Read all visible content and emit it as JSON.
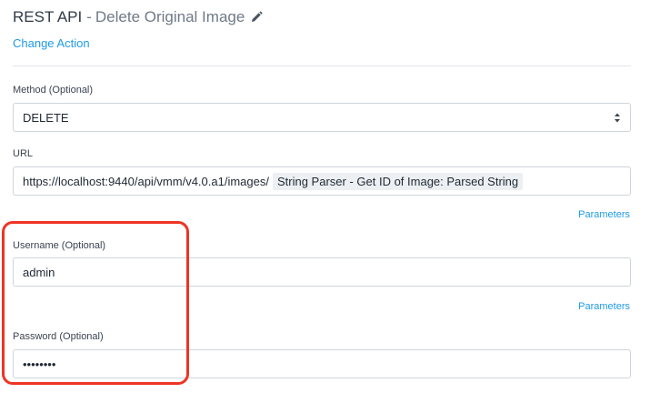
{
  "header": {
    "title": "REST API",
    "separator": "-",
    "subtitle": "Delete Original Image",
    "edit_icon": "pencil-icon",
    "change_action_label": "Change Action"
  },
  "form": {
    "method": {
      "label": "Method (Optional)",
      "value": "DELETE",
      "select_icon": "up-down-arrows-icon"
    },
    "url": {
      "label": "URL",
      "value": "https://localhost:9440/api/vmm/v4.0.a1/images/",
      "token": "String Parser - Get ID of Image: Parsed String",
      "parameters_link": "Parameters"
    },
    "username": {
      "label": "Username (Optional)",
      "value": "admin",
      "parameters_link": "Parameters"
    },
    "password": {
      "label": "Password (Optional)",
      "value": "••••••••"
    }
  },
  "colors": {
    "link": "#1e9be6",
    "highlight_border": "#ee3424",
    "input_border": "#cfd5dc",
    "token_background": "#edf0f3"
  }
}
